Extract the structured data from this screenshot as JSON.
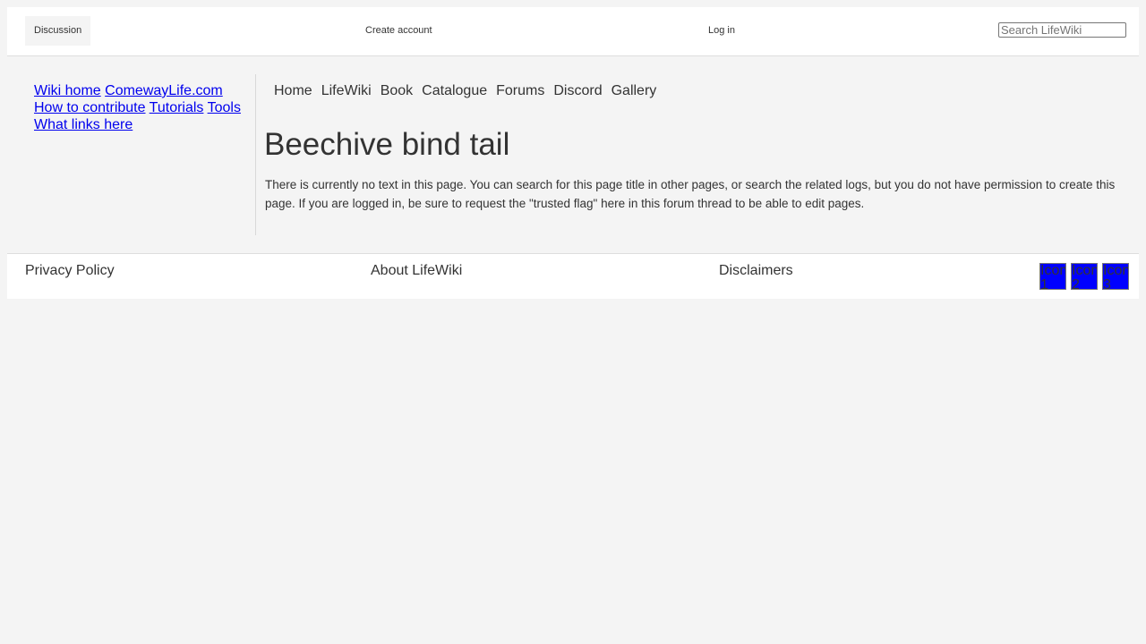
{
  "header": {
    "tab_discussion": "Discussion",
    "create_account": "Create account",
    "log_in": "Log in",
    "search_placeholder": "Search LifeWiki"
  },
  "sidebar": {
    "links": [
      "Wiki home",
      "ComewayLife.com",
      "How to contribute",
      "Tutorials",
      "Tools",
      "What links here"
    ]
  },
  "main": {
    "nav": [
      "Home",
      "LifeWiki",
      "Book",
      "Catalogue",
      "Forums",
      "Discord",
      "Gallery"
    ],
    "title": "Beechive bind tail",
    "text": "There is currently no text in this page. You can search for this page title in other pages, or search the related logs, but you do not have permission to create this page. If you are logged in, be sure to request the \"trusted flag\" here in this forum thread to be able to edit pages."
  },
  "footer": {
    "privacy": "Privacy Policy",
    "about": "About LifeWiki",
    "disclaimers": "Disclaimers",
    "icons": [
      {
        "label": "Icon 1",
        "color": "#0000ff"
      },
      {
        "label": "Icon 2",
        "color": "#0000ff"
      },
      {
        "label": "Icon 3",
        "color": "#0000ff"
      }
    ]
  }
}
